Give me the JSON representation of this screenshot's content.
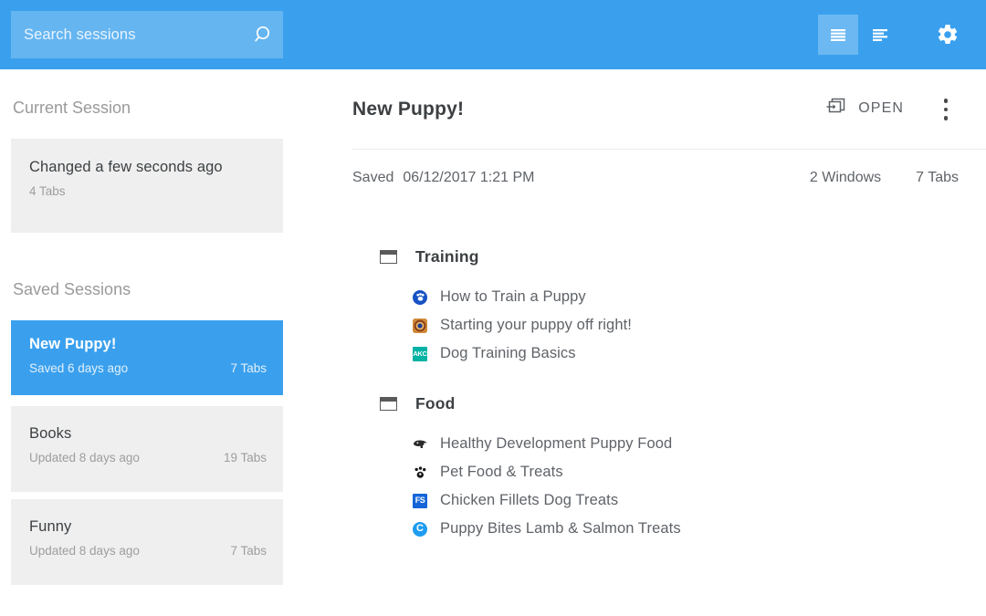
{
  "colors": {
    "accent": "#3AA0EE",
    "card_bg": "#efefef",
    "text_primary": "#3c4043",
    "text_secondary": "#5f6368",
    "text_muted": "#9e9e9e"
  },
  "topbar": {
    "search": {
      "placeholder": "Search sessions",
      "value": "",
      "icon": "search-icon"
    },
    "view_compact": {
      "icon": "list-compact-view-icon",
      "selected": true
    },
    "view_detailed": {
      "icon": "list-detailed-view-icon",
      "selected": false
    },
    "settings": {
      "icon": "gear-icon",
      "label": "Settings"
    }
  },
  "sidebar": {
    "current_heading": "Current Session",
    "current_session": {
      "title": "Changed a few seconds ago",
      "tabs": "4 Tabs"
    },
    "saved_heading": "Saved Sessions",
    "saved_sessions": [
      {
        "title": "New Puppy!",
        "subtitle": "Saved 6 days ago",
        "tabs": "7 Tabs",
        "selected": true
      },
      {
        "title": "Books",
        "subtitle": "Updated 8 days ago",
        "tabs": "19 Tabs",
        "selected": false
      },
      {
        "title": "Funny",
        "subtitle": "Updated 8 days ago",
        "tabs": "7 Tabs",
        "selected": false
      }
    ]
  },
  "main": {
    "title": "New Puppy!",
    "open_label": "OPEN",
    "open_icon": "restore-window-icon",
    "menu_icon": "kebab-menu-icon",
    "meta": {
      "saved_label": "Saved",
      "saved_date": "06/12/2017 1:21 PM",
      "windows": "2 Windows",
      "tabs": "7 Tabs"
    },
    "windows": [
      {
        "name": "Training",
        "icon": "browser-window-icon",
        "tabs": [
          {
            "title": "How to Train a Puppy",
            "favicon": "paw-blue-favicon",
            "glyph": "✿"
          },
          {
            "title": "Starting your puppy off right!",
            "favicon": "rings-orange-favicon",
            "glyph": "◉"
          },
          {
            "title": "Dog Training Basics",
            "favicon": "akc-favicon",
            "glyph": "AKC"
          }
        ]
      },
      {
        "name": "Food",
        "icon": "browser-window-icon",
        "tabs": [
          {
            "title": "Healthy Development Puppy Food",
            "favicon": "dog-head-favicon",
            "glyph": "◜"
          },
          {
            "title": "Pet Food & Treats",
            "favicon": "paw-black-favicon",
            "glyph": "✿"
          },
          {
            "title": "Chicken Fillets Dog Treats",
            "favicon": "fs-favicon",
            "glyph": "FS"
          },
          {
            "title": "Puppy Bites Lamb & Salmon Treats",
            "favicon": "c-blue-favicon",
            "glyph": "C"
          }
        ]
      }
    ]
  }
}
